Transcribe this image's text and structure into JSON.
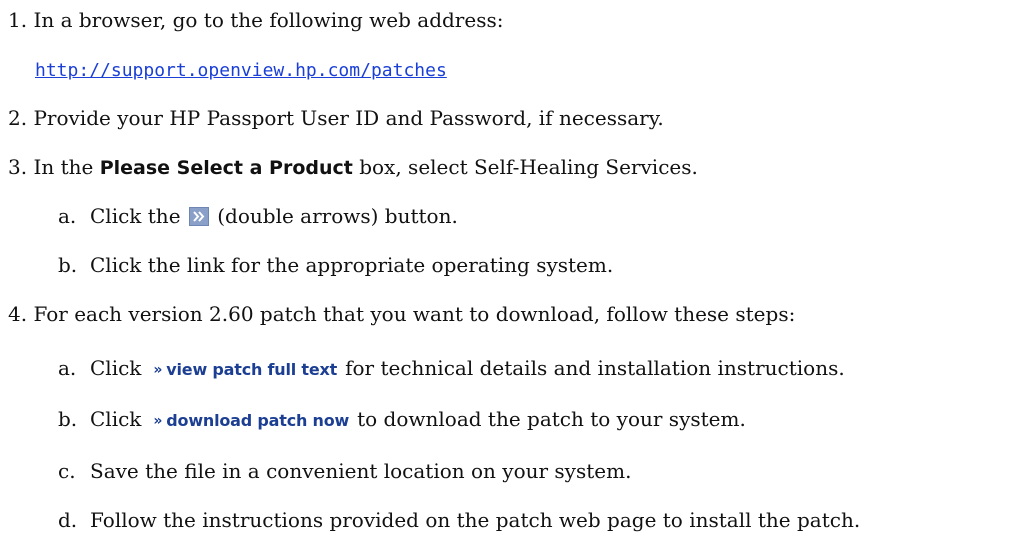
{
  "steps": {
    "s1": {
      "num": "1.",
      "text": "In a browser, go to the following web address:"
    },
    "url": "http://support.openview.hp.com/patches",
    "s2": {
      "num": "2.",
      "text": "Provide your HP Passport User ID and Password, if necessary."
    },
    "s3": {
      "num": "3.",
      "before": "In the ",
      "bold": "Please Select a Product",
      "after": " box, select Self-Healing Services."
    },
    "s3a": {
      "letter": "a.",
      "before": "Click the",
      "after": "(double arrows) button."
    },
    "s3b": {
      "letter": "b.",
      "text": "Click the link for the appropriate operating system."
    },
    "s4": {
      "num": "4.",
      "text": "For each version 2.60 patch that you want to download, follow these steps:"
    },
    "s4a": {
      "letter": "a.",
      "before": "Click",
      "link_arrow": "»",
      "link": "view patch full text",
      "after": "for technical details and installation instructions."
    },
    "s4b": {
      "letter": "b.",
      "before": "Click",
      "link_arrow": "»",
      "link": "download patch now",
      "after": "to download the patch to your system."
    },
    "s4c": {
      "letter": "c.",
      "text": "Save the file in a convenient location on your system."
    },
    "s4d": {
      "letter": "d.",
      "text": "Follow the instructions provided on the patch web page to install the patch."
    }
  },
  "icons": {
    "double_arrow_button": "double-arrow-icon"
  },
  "colors": {
    "link": "#1a3fd6",
    "patch_link": "#1c3f93",
    "button_bg": "#6e86b4"
  }
}
